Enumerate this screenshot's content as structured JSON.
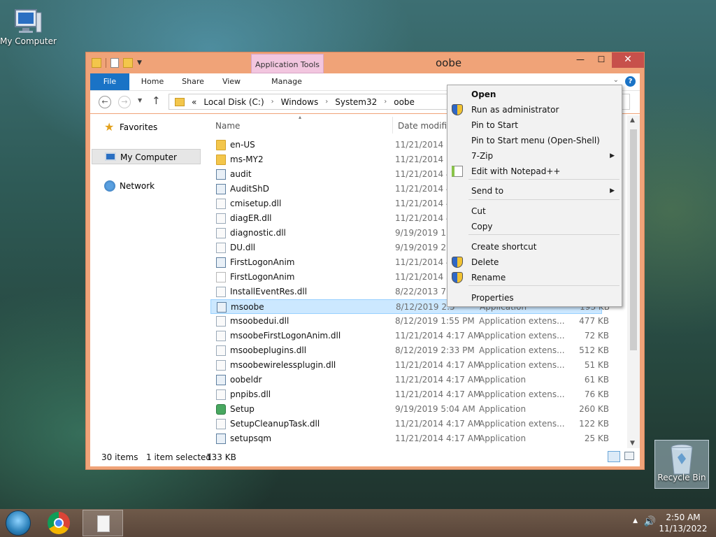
{
  "desktop": {
    "my_computer_label": "My Computer",
    "recycle_bin_label": "Recycle Bin"
  },
  "window": {
    "title": "oobe",
    "contextual_tab_group": "Application Tools",
    "ribbon_tabs": [
      "File",
      "Home",
      "Share",
      "View",
      "Manage"
    ],
    "address": {
      "overflow": "«",
      "crumbs": [
        "Local Disk (C:)",
        "Windows",
        "System32",
        "oobe"
      ]
    },
    "nav": {
      "favorites": "Favorites",
      "my_computer": "My Computer",
      "network": "Network"
    },
    "columns": {
      "name": "Name",
      "date_modified": "Date modified"
    },
    "files": [
      {
        "name": "en-US",
        "date": "11/21/2014 11",
        "type": "",
        "size": "",
        "icon": "folder"
      },
      {
        "name": "ms-MY2",
        "date": "11/21/2014 11",
        "type": "",
        "size": "",
        "icon": "folder"
      },
      {
        "name": "audit",
        "date": "11/21/2014 4:",
        "type": "",
        "size": "",
        "icon": "exe"
      },
      {
        "name": "AuditShD",
        "date": "11/21/2014 4:",
        "type": "",
        "size": "",
        "icon": "exe"
      },
      {
        "name": "cmisetup.dll",
        "date": "11/21/2014 4:",
        "type": "",
        "size": "",
        "icon": "dll"
      },
      {
        "name": "diagER.dll",
        "date": "11/21/2014 4:",
        "type": "",
        "size": "",
        "icon": "dll"
      },
      {
        "name": "diagnostic.dll",
        "date": "9/19/2019 1:5",
        "type": "",
        "size": "",
        "icon": "dll"
      },
      {
        "name": "DU.dll",
        "date": "9/19/2019 2:0",
        "type": "",
        "size": "",
        "icon": "dll"
      },
      {
        "name": "FirstLogonAnim",
        "date": "11/21/2014 4:",
        "type": "",
        "size": "",
        "icon": "exe"
      },
      {
        "name": "FirstLogonAnim",
        "date": "11/21/2014 3:",
        "type": "",
        "size": "",
        "icon": "txt"
      },
      {
        "name": "InstallEventRes.dll",
        "date": "8/22/2013 7:4",
        "type": "",
        "size": "",
        "icon": "dll"
      },
      {
        "name": "msoobe",
        "date": "8/12/2019 2:5",
        "type": "Application",
        "size": "193 KB",
        "icon": "exe",
        "selected": true
      },
      {
        "name": "msoobedui.dll",
        "date": "8/12/2019 1:55 PM",
        "type": "Application extens...",
        "size": "477 KB",
        "icon": "dll"
      },
      {
        "name": "msoobeFirstLogonAnim.dll",
        "date": "11/21/2014 4:17 AM",
        "type": "Application extens...",
        "size": "72 KB",
        "icon": "dll"
      },
      {
        "name": "msoobeplugins.dll",
        "date": "8/12/2019 2:33 PM",
        "type": "Application extens...",
        "size": "512 KB",
        "icon": "dll"
      },
      {
        "name": "msoobewirelessplugin.dll",
        "date": "11/21/2014 4:17 AM",
        "type": "Application extens...",
        "size": "51 KB",
        "icon": "dll"
      },
      {
        "name": "oobeldr",
        "date": "11/21/2014 4:17 AM",
        "type": "Application",
        "size": "61 KB",
        "icon": "exe"
      },
      {
        "name": "pnpibs.dll",
        "date": "11/21/2014 4:17 AM",
        "type": "Application extens...",
        "size": "76 KB",
        "icon": "dll"
      },
      {
        "name": "Setup",
        "date": "9/19/2019 5:04 AM",
        "type": "Application",
        "size": "260 KB",
        "icon": "setup"
      },
      {
        "name": "SetupCleanupTask.dll",
        "date": "11/21/2014 4:17 AM",
        "type": "Application extens...",
        "size": "122 KB",
        "icon": "dll"
      },
      {
        "name": "setupsqm",
        "date": "11/21/2014 4:17 AM",
        "type": "Application",
        "size": "25 KB",
        "icon": "exe"
      }
    ],
    "status": {
      "count": "30 items",
      "selection": "1 item selected",
      "size": "133 KB"
    }
  },
  "context_menu": {
    "items": [
      {
        "label": "Open",
        "bold": true
      },
      {
        "label": "Run as administrator",
        "icon": "shield-icon"
      },
      {
        "label": "Pin to Start"
      },
      {
        "label": "Pin to Start menu (Open-Shell)"
      },
      {
        "label": "7-Zip",
        "submenu": true
      },
      {
        "label": "Edit with Notepad++",
        "icon": "notepadpp-icon"
      },
      {
        "label": "Send to",
        "submenu": true
      },
      {
        "label": "Cut"
      },
      {
        "label": "Copy"
      },
      {
        "label": "Create shortcut"
      },
      {
        "label": "Delete",
        "icon": "shield-icon"
      },
      {
        "label": "Rename",
        "icon": "shield-icon"
      },
      {
        "label": "Properties"
      }
    ]
  },
  "taskbar": {
    "time": "2:50 AM",
    "date": "11/13/2022"
  }
}
